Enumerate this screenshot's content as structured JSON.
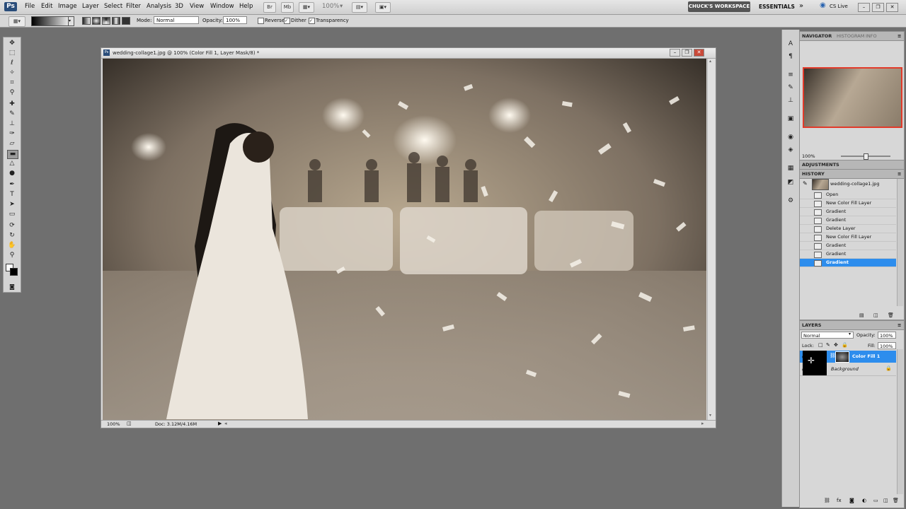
{
  "app": {
    "logo": "Ps"
  },
  "menu": [
    "File",
    "Edit",
    "Image",
    "Layer",
    "Select",
    "Filter",
    "Analysis",
    "3D",
    "View",
    "Window",
    "Help"
  ],
  "appbar": {
    "zoom": "100%",
    "workspace": "CHUCK'S WORKSPACE",
    "essentials": "ESSENTIALS",
    "cs_live": "CS Live"
  },
  "options": {
    "mode_label": "Mode:",
    "mode_value": "Normal",
    "opacity_label": "Opacity:",
    "opacity_value": "100%",
    "reverse": "Reverse",
    "dither": "Dither",
    "transparency": "Transparency"
  },
  "document": {
    "title": "wedding-collage1.jpg @ 100% (Color Fill 1, Layer Mask/8) *",
    "zoom": "100%",
    "doc_size": "Doc: 3.12M/4.16M"
  },
  "navigator": {
    "tab_active": "NAVIGATOR",
    "tab_other": "HISTOGRAM",
    "tab_other2": "INFO",
    "zoom": "100%"
  },
  "adjustments": {
    "title": "ADJUSTMENTS"
  },
  "history": {
    "title": "HISTORY",
    "snapshot": "wedding-collage1.jpg",
    "items": [
      "Open",
      "New Color Fill Layer",
      "Gradient",
      "Gradient",
      "Delete Layer",
      "New Color Fill Layer",
      "Gradient",
      "Gradient",
      "Gradient"
    ]
  },
  "layers": {
    "title": "LAYERS",
    "blend": "Normal",
    "opacity_label": "Opacity:",
    "opacity_value": "100%",
    "lock_label": "Lock:",
    "fill_label": "Fill:",
    "fill_value": "100%",
    "items": [
      "Color Fill 1",
      "Background"
    ]
  },
  "colors": {
    "selection": "#2d8ded",
    "workspace_bg": "#6f6f6f"
  }
}
